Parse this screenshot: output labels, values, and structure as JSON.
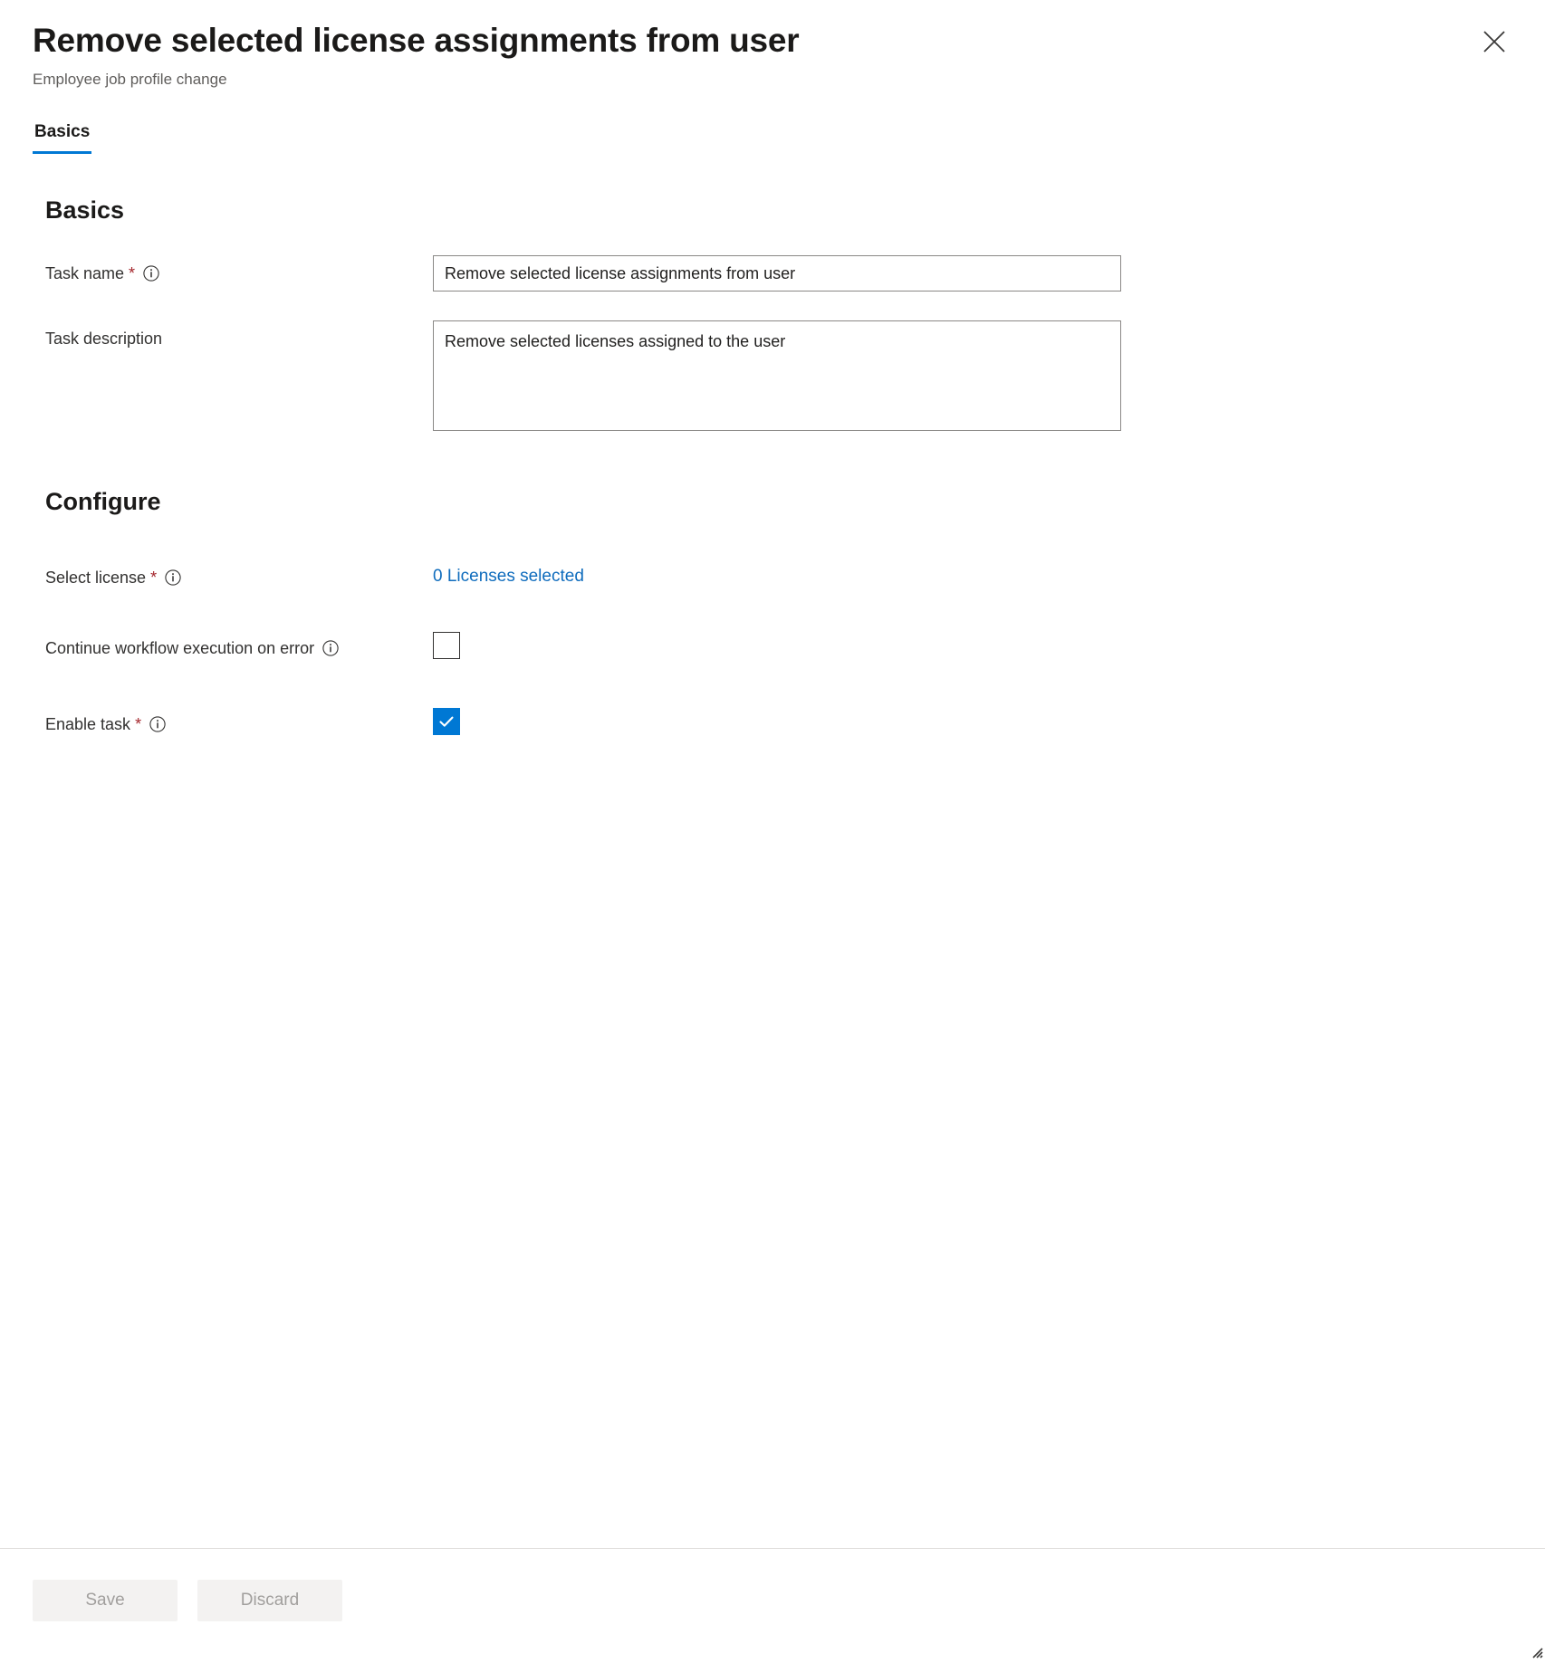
{
  "header": {
    "title": "Remove selected license assignments from user",
    "subtitle": "Employee job profile change",
    "close_label": "Close"
  },
  "tabs": [
    {
      "label": "Basics",
      "selected": true
    }
  ],
  "sections": {
    "basics": {
      "heading": "Basics",
      "task_name": {
        "label": "Task name",
        "required": "*",
        "info": "i",
        "value": "Remove selected license assignments from user",
        "placeholder": "Enter a task name"
      },
      "task_description": {
        "label": "Task description",
        "value": "Remove selected licenses assigned to the user",
        "placeholder": "Enter a task description"
      }
    },
    "configure": {
      "heading": "Configure",
      "select_license": {
        "label": "Select license",
        "required": "*",
        "info": "i",
        "link_text": "0 Licenses selected"
      },
      "continue_on_error": {
        "label": "Continue workflow execution on error",
        "info": "i",
        "checked": false
      },
      "enable_task": {
        "label": "Enable task",
        "required": "*",
        "info": "i",
        "checked": true
      }
    }
  },
  "footer": {
    "save_label": "Save",
    "discard_label": "Discard"
  },
  "colors": {
    "accent": "#0078d4",
    "link": "#0f6cbd",
    "required": "#a4262c",
    "text_primary": "#1b1a19",
    "text_secondary": "#605e5c",
    "border": "#8a8886",
    "disabled_button_bg": "#f3f2f1",
    "disabled_button_text": "#a19f9d"
  }
}
